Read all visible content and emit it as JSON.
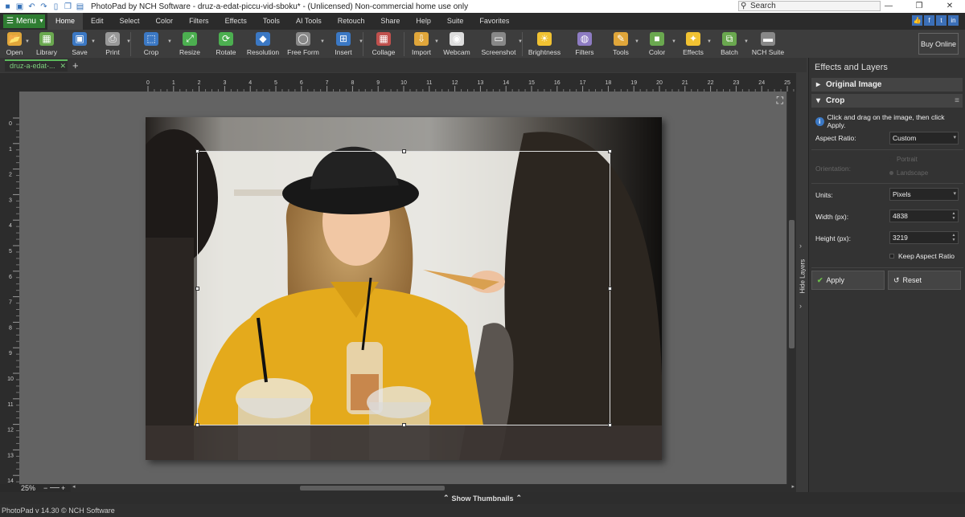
{
  "window": {
    "title": "PhotoPad by NCH Software - druz-a-edat-piccu-vid-sboku* - (Unlicensed) Non-commercial home use only",
    "search_placeholder": "Search"
  },
  "menu": {
    "menu_button": "Menu",
    "tabs": [
      "Home",
      "Edit",
      "Select",
      "Color",
      "Filters",
      "Effects",
      "Tools",
      "AI Tools",
      "Retouch",
      "Share",
      "Help",
      "Suite",
      "Favorites"
    ],
    "active_tab": "Home"
  },
  "ribbon": {
    "buttons": [
      {
        "label": "Open",
        "icon": "folder-open-icon",
        "color": "#e0a63a"
      },
      {
        "label": "Library",
        "icon": "image-library-icon",
        "color": "#6aa84f"
      },
      {
        "label": "Save",
        "icon": "floppy-disk-icon",
        "color": "#3b78c4"
      },
      {
        "label": "Print",
        "icon": "printer-icon",
        "color": "#999999"
      },
      {
        "label": "Crop",
        "icon": "crop-icon",
        "color": "#3b78c4"
      },
      {
        "label": "Resize",
        "icon": "resize-icon",
        "color": "#4caf50"
      },
      {
        "label": "Rotate",
        "icon": "rotate-icon",
        "color": "#4caf50"
      },
      {
        "label": "Resolution",
        "icon": "resolution-icon",
        "color": "#3b78c4"
      },
      {
        "label": "Free Form",
        "icon": "free-form-icon",
        "color": "#888888"
      },
      {
        "label": "Insert",
        "icon": "insert-icon",
        "color": "#3b78c4"
      },
      {
        "label": "Collage",
        "icon": "collage-icon",
        "color": "#c0504d"
      },
      {
        "label": "Import",
        "icon": "import-icon",
        "color": "#e0a63a"
      },
      {
        "label": "Webcam",
        "icon": "webcam-icon",
        "color": "#dddddd"
      },
      {
        "label": "Screenshot",
        "icon": "screenshot-icon",
        "color": "#888888"
      },
      {
        "label": "Brightness",
        "icon": "brightness-icon",
        "color": "#f1c232"
      },
      {
        "label": "Filters",
        "icon": "filters-icon",
        "color": "#8e7cc3"
      },
      {
        "label": "Tools",
        "icon": "tools-icon",
        "color": "#e0a63a"
      },
      {
        "label": "Color",
        "icon": "color-icon",
        "color": "#6aa84f"
      },
      {
        "label": "Effects",
        "icon": "effects-icon",
        "color": "#f1c232"
      },
      {
        "label": "Batch",
        "icon": "batch-icon",
        "color": "#6aa84f"
      },
      {
        "label": "NCH Suite",
        "icon": "nch-suite-icon",
        "color": "#888888"
      }
    ],
    "buy_online": "Buy Online"
  },
  "document": {
    "tab_label": "druz-a-edat-...",
    "zoom": "25%"
  },
  "rulers": {
    "horizontal": [
      "0",
      "1",
      "2",
      "3",
      "4",
      "5",
      "6",
      "7",
      "8",
      "9",
      "10",
      "11",
      "12",
      "13",
      "14",
      "15",
      "16",
      "17",
      "18",
      "19",
      "20",
      "21",
      "22",
      "23",
      "24",
      "25"
    ],
    "vertical": [
      "0",
      "1",
      "2",
      "3",
      "4",
      "5",
      "6",
      "7",
      "8",
      "9",
      "10",
      "11",
      "12",
      "13",
      "14"
    ]
  },
  "panel": {
    "title": "Effects and Layers",
    "original_image": "Original Image",
    "crop_section": "Crop",
    "info": "Click and drag on the image, then click Apply.",
    "aspect_ratio_label": "Aspect Ratio:",
    "aspect_ratio_value": "Custom",
    "orientation_label": "Orientation:",
    "orientation_portrait": "Portrait",
    "orientation_landscape": "Landscape",
    "units_label": "Units:",
    "units_value": "Pixels",
    "width_label": "Width (px):",
    "width_value": "4838",
    "height_label": "Height (px):",
    "height_value": "3219",
    "keep_aspect": "Keep Aspect Ratio",
    "apply": "Apply",
    "reset": "Reset"
  },
  "hide_layers": "Hide Layers",
  "show_thumbnails": "Show Thumbnails",
  "status": "PhotoPad v 14.30 © NCH Software"
}
